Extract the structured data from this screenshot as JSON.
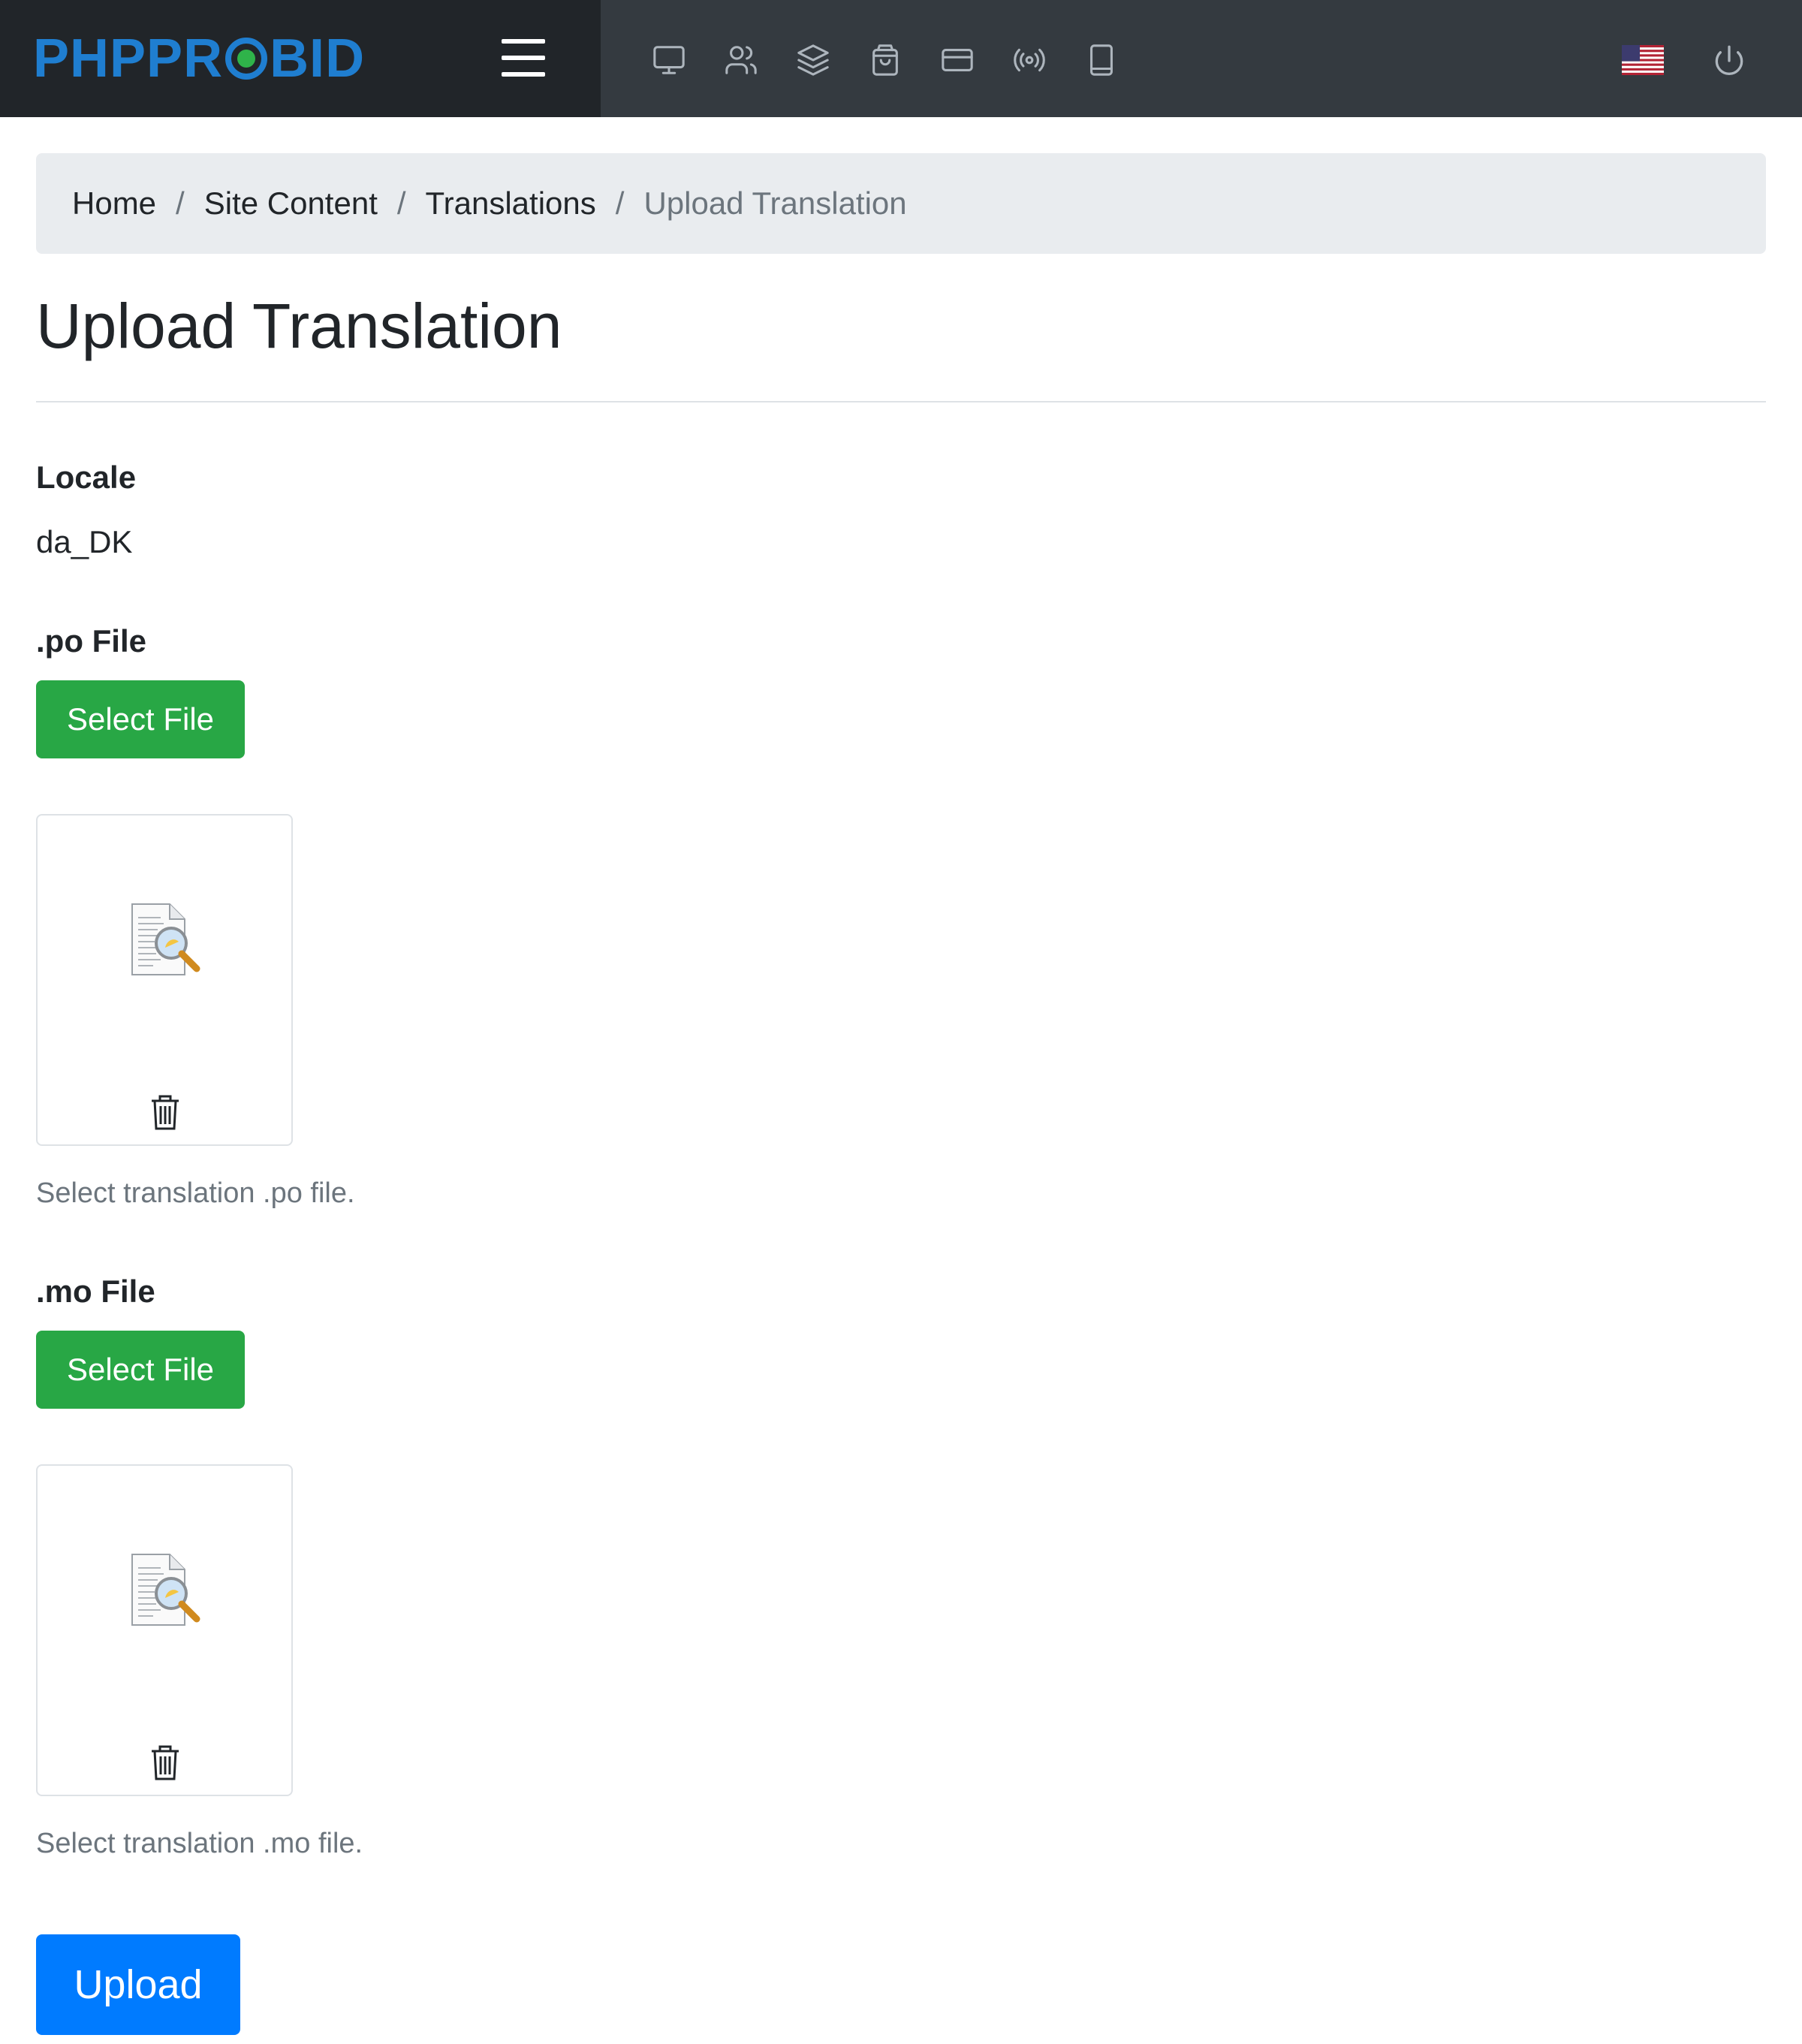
{
  "header": {
    "logo_text_left": "PHPPR",
    "logo_text_right": "BID",
    "brand_color": "#1f7ed0",
    "menu_icon": "hamburger-menu-icon",
    "nav_icons": [
      "monitor-icon",
      "users-icon",
      "layers-icon",
      "shopping-bag-icon",
      "credit-card-icon",
      "broadcast-icon",
      "book-icon"
    ],
    "language_flag": "us-flag-icon",
    "logout_icon": "power-icon"
  },
  "breadcrumb": {
    "items": [
      "Home",
      "Site Content",
      "Translations"
    ],
    "active": "Upload Translation",
    "separator": "/"
  },
  "page": {
    "title": "Upload Translation"
  },
  "form": {
    "locale_label": "Locale",
    "locale_value": "da_DK",
    "po": {
      "label": ".po File",
      "button": "Select File",
      "hint": "Select translation .po file."
    },
    "mo": {
      "label": ".mo File",
      "button": "Select File",
      "hint": "Select translation .mo file."
    },
    "submit": "Upload"
  },
  "colors": {
    "navbar": "#343a40",
    "navbar_brand": "#212529",
    "success": "#28a745",
    "primary": "#007bff",
    "breadcrumb_bg": "#e9ecef"
  }
}
